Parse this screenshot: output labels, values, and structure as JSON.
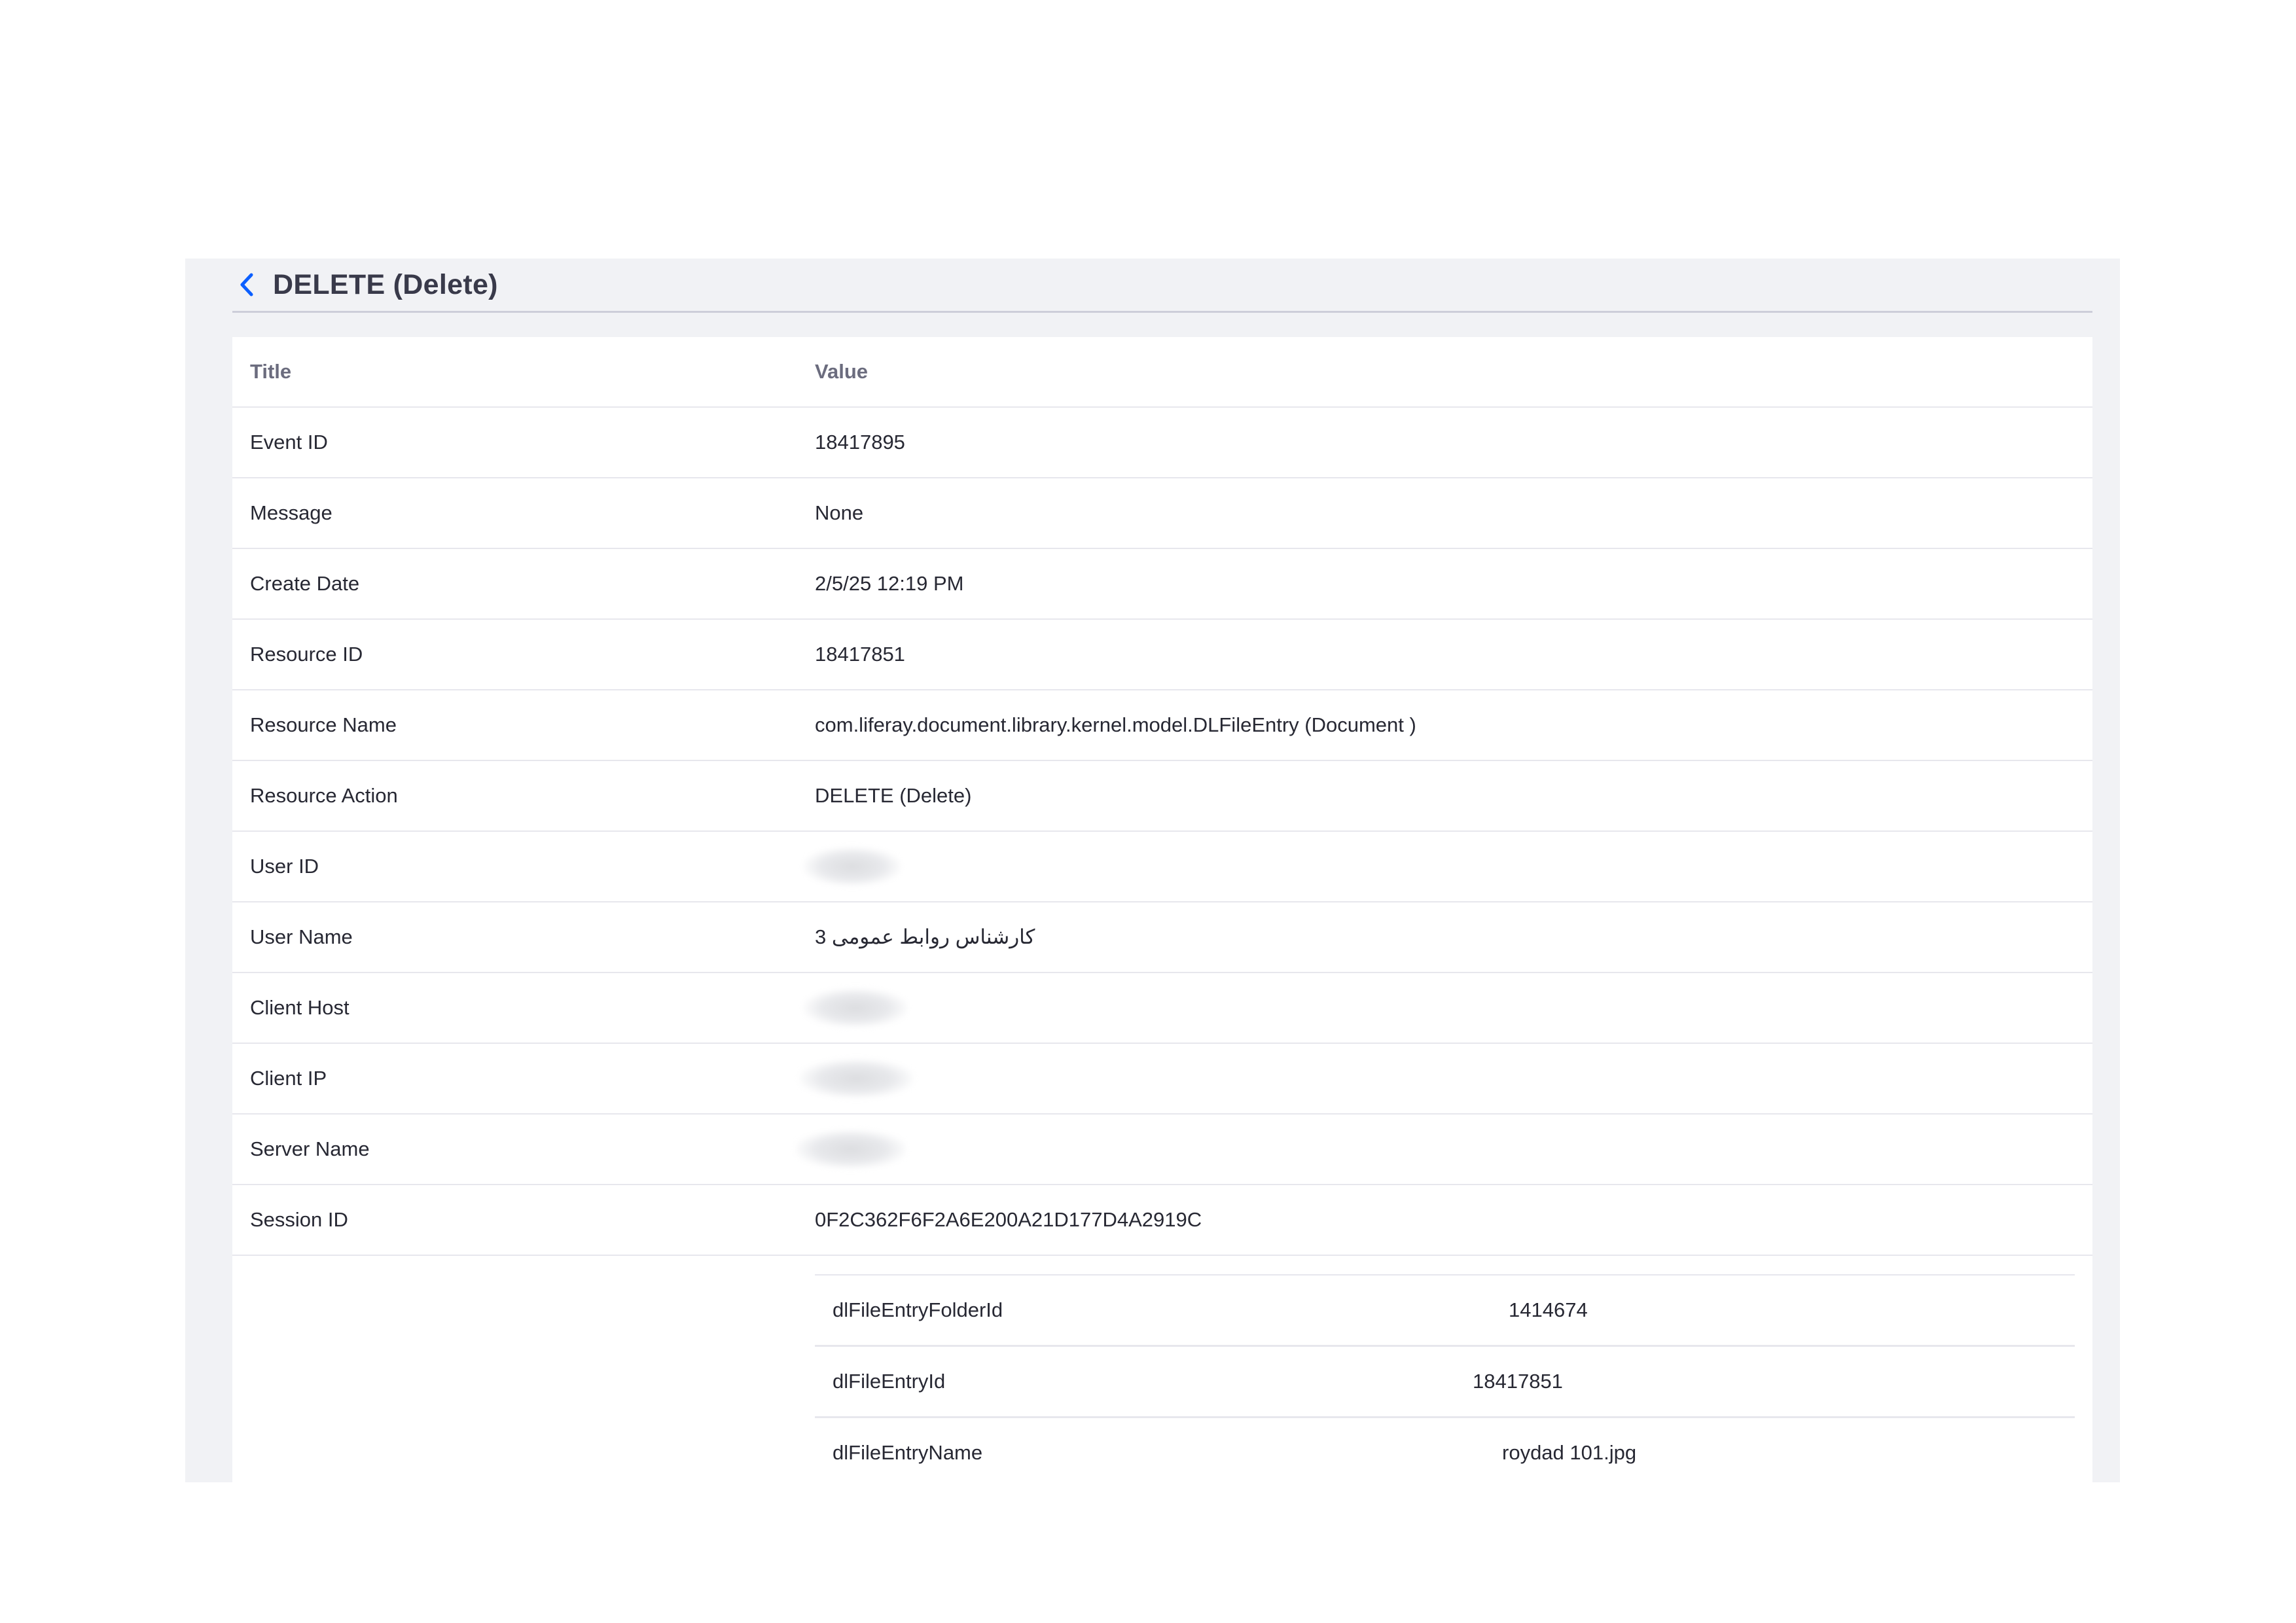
{
  "header": {
    "title": "DELETE (Delete)",
    "back_icon": "chevron-left-icon",
    "accent_color": "#0b5fff"
  },
  "table": {
    "columns": [
      "Title",
      "Value"
    ],
    "rows": [
      {
        "title": "Event ID",
        "value": "18417895"
      },
      {
        "title": "Message",
        "value": "None"
      },
      {
        "title": "Create Date",
        "value": "2/5/25 12:19 PM"
      },
      {
        "title": "Resource ID",
        "value": "18417851"
      },
      {
        "title": "Resource Name",
        "value": "com.liferay.document.library.kernel.model.DLFileEntry (Document )"
      },
      {
        "title": "Resource Action",
        "value": "DELETE (Delete)"
      },
      {
        "title": "User ID",
        "value": ""
      },
      {
        "title": "User Name",
        "value": "کارشناس روابط عمومی 3"
      },
      {
        "title": "Client Host",
        "value": ""
      },
      {
        "title": "Client IP",
        "value": ""
      },
      {
        "title": "Server Name",
        "value": ""
      },
      {
        "title": "Session ID",
        "value": "0F2C362F6F2A6E200A21D177D4A2919C"
      }
    ],
    "additional_info": [
      {
        "key": "dlFileEntryFolderId",
        "value": "1414674"
      },
      {
        "key": "dlFileEntryId",
        "value": "18417851"
      },
      {
        "key": "dlFileEntryName",
        "value": "roydad 101.jpg"
      }
    ]
  }
}
